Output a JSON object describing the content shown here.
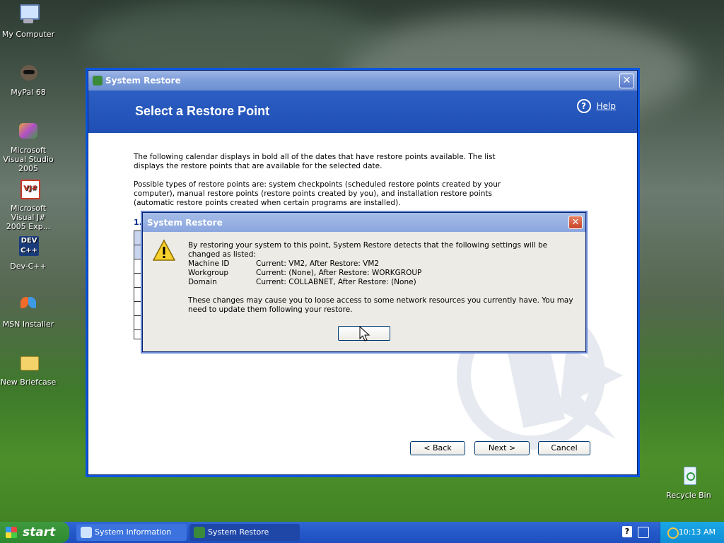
{
  "desktop": {
    "icons": [
      {
        "label": "My Computer"
      },
      {
        "label": "MyPal 68"
      },
      {
        "label": "Microsoft Visual Studio 2005"
      },
      {
        "label": "Microsoft Visual J# 2005 Exp..."
      },
      {
        "label": "Dev-C++"
      },
      {
        "label": "MSN Installer"
      },
      {
        "label": "New Briefcase"
      },
      {
        "label": "Recycle Bin"
      }
    ]
  },
  "window": {
    "title": "System Restore",
    "header": "Select a Restore Point",
    "help_label": "Help",
    "intro": "The following calendar displays in bold all of the dates that have restore points available. The list displays the restore points that are available for the selected date.",
    "types": "Possible types of restore points are: system checkpoints (scheduled restore points created by your computer), manual restore points (restore points created by you), and installation restore points (automatic restore points created when certain programs are installed).",
    "step_prefix": "1.",
    "back_label": "< Back",
    "next_label": "Next >",
    "cancel_label": "Cancel"
  },
  "dialog": {
    "title": "System Restore",
    "message": "By restoring your system to this point, System Restore detects that the following settings will be changed as listed:",
    "rows": [
      {
        "key": "Machine ID",
        "value": "Current: VM2, After Restore: VM2"
      },
      {
        "key": "Workgroup",
        "value": "Current: (None), After Restore: WORKGROUP"
      },
      {
        "key": "Domain",
        "value": "Current: COLLABNET, After Restore: (None)"
      }
    ],
    "footer": "These changes may cause you to loose access to some network resources you currently have.  You may need to update them following your restore.",
    "ok_label": ""
  },
  "taskbar": {
    "start_label": "start",
    "tasks": [
      {
        "label": "System Information"
      },
      {
        "label": "System Restore"
      }
    ],
    "clock": "10:13 AM"
  },
  "colors": {
    "accent": "#1f4fb5",
    "taskbar": "#2458c9",
    "start": "#2f8a2f"
  }
}
